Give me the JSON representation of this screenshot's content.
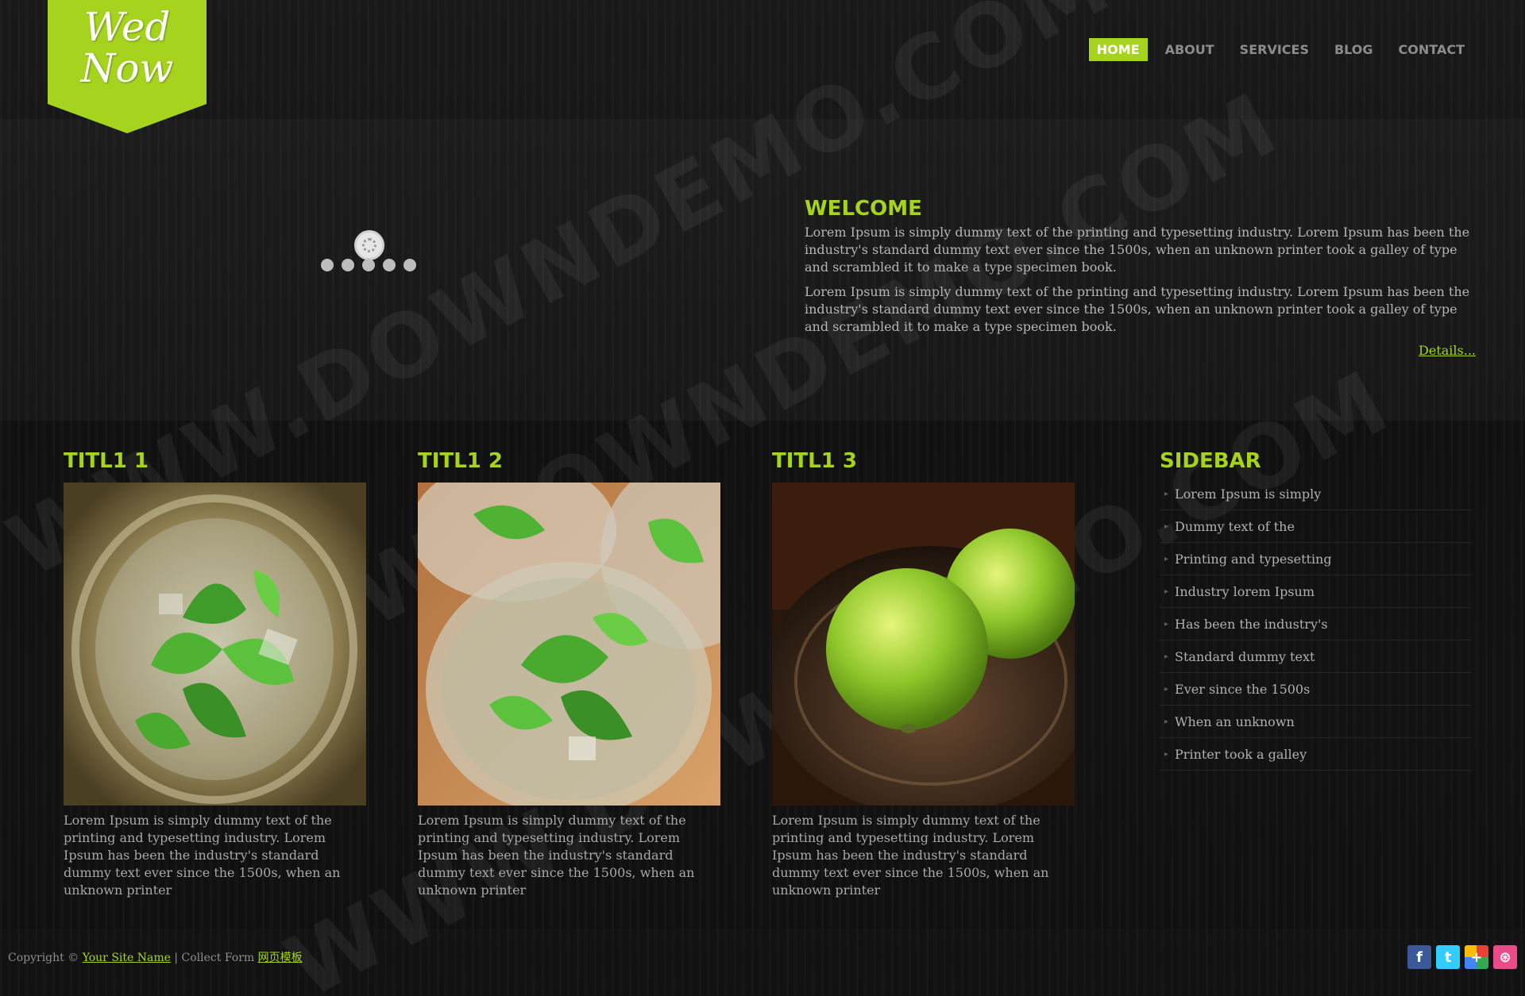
{
  "logo": {
    "line1": "Wed",
    "line2": "Now"
  },
  "nav": {
    "items": [
      "HOME",
      "ABOUT",
      "SERVICES",
      "BLOG",
      "CONTACT"
    ],
    "active": "HOME"
  },
  "slider": {
    "dot_count": 5
  },
  "welcome": {
    "title": "WELCOME",
    "paragraphs": [
      "Lorem Ipsum is simply dummy text of the printing and typesetting industry. Lorem Ipsum has been the industry's standard dummy text ever since the 1500s, when an unknown printer took a galley of type and scrambled it to make a type specimen book.",
      "Lorem Ipsum is simply dummy text of the printing and typesetting industry. Lorem Ipsum has been the industry's standard dummy text ever since the 1500s, when an unknown printer took a galley of type and scrambled it to make a type specimen book."
    ],
    "details_link": "Details..."
  },
  "columns": [
    {
      "title": "TITL1 1",
      "text": "Lorem Ipsum is simply dummy text of the printing and typesetting industry. Lorem Ipsum has been the industry's standard dummy text ever since the 1500s, when an unknown printer"
    },
    {
      "title": "TITL1 2",
      "text": "Lorem Ipsum is simply dummy text of the printing and typesetting industry. Lorem Ipsum has been the industry's standard dummy text ever since the 1500s, when an unknown printer"
    },
    {
      "title": "TITL1 3",
      "text": "Lorem Ipsum is simply dummy text of the printing and typesetting industry. Lorem Ipsum has been the industry's standard dummy text ever since the 1500s, when an unknown printer"
    }
  ],
  "sidebar": {
    "title": "SIDEBAR",
    "items": [
      "Lorem Ipsum is simply",
      "Dummy text of the",
      "Printing and typesetting",
      "Industry lorem Ipsum",
      "Has been the industry's",
      "Standard dummy text",
      "Ever since the 1500s",
      "When an unknown",
      "Printer took a galley"
    ]
  },
  "footer": {
    "copyright": "Copyright ©",
    "site_link": "Your Site Name",
    "separator": "| Collect Form",
    "template_link": "网页模板"
  },
  "social": {
    "icons": [
      "facebook-icon",
      "twitter-icon",
      "google-plus-icon",
      "dribbble-icon"
    ],
    "glyphs": [
      "f",
      "t",
      "+",
      "⊛"
    ],
    "colors": [
      "#3b5998",
      "#33ccff",
      "#e8e8e8",
      "#ea4c89"
    ]
  },
  "watermark": {
    "text": "WWW.DOWNDEMO.COM"
  },
  "colors": {
    "accent": "#a6d41e",
    "background": "#141414"
  }
}
